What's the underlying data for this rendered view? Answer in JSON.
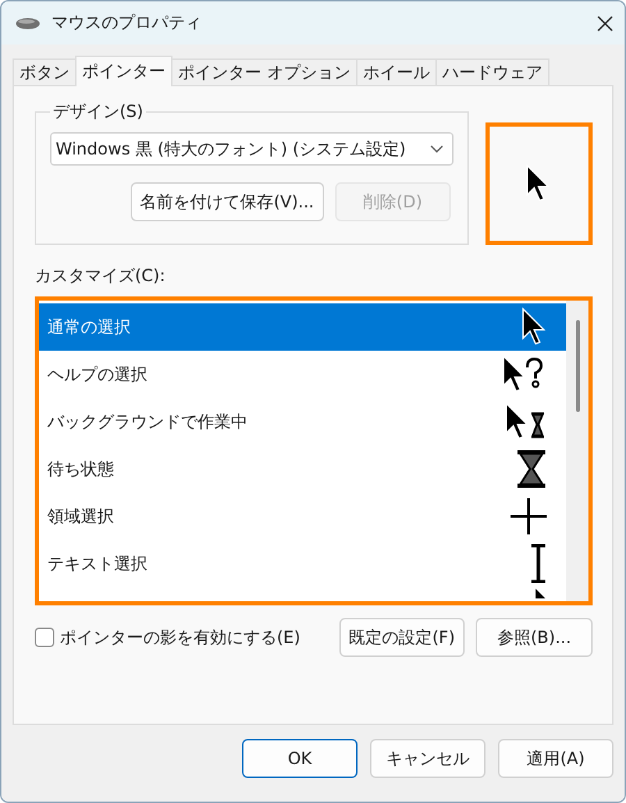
{
  "window": {
    "title": "マウスのプロパティ"
  },
  "tabs": [
    {
      "label": "ボタン",
      "selected": false
    },
    {
      "label": "ポインター",
      "selected": true
    },
    {
      "label": "ポインター オプション",
      "selected": false
    },
    {
      "label": "ホイール",
      "selected": false
    },
    {
      "label": "ハードウェア",
      "selected": false
    }
  ],
  "design": {
    "label": "デザイン(S)",
    "scheme": "Windows 黒 (特大のフォント) (システム設定)",
    "buttons": [
      {
        "label": "名前を付けて保存(V)...",
        "disabled": false
      },
      {
        "label": "削除(D)",
        "disabled": true
      }
    ]
  },
  "preview": {
    "highlighted": true,
    "kind": "arrow"
  },
  "customize": {
    "label": "カスタマイズ(C):",
    "highlighted": true,
    "rows": [
      {
        "label": "通常の選択",
        "kind": "arrow",
        "selected": true
      },
      {
        "label": "ヘルプの選択",
        "kind": "help",
        "selected": false
      },
      {
        "label": "バックグラウンドで作業中",
        "kind": "working",
        "selected": false
      },
      {
        "label": "待ち状態",
        "kind": "busy",
        "selected": false
      },
      {
        "label": "領域選択",
        "kind": "cross",
        "selected": false
      },
      {
        "label": "テキスト選択",
        "kind": "text",
        "selected": false
      },
      {
        "kind": "arrow",
        "selected": false
      }
    ]
  },
  "shadow": {
    "label": "ポインターの影を有効にする(E)",
    "checked": false
  },
  "side_buttons": [
    "既定の設定(F)",
    "参照(B)..."
  ],
  "footer_buttons": [
    {
      "label": "OK",
      "default": true
    },
    {
      "label": "キャンセル",
      "default": false
    },
    {
      "label": "適用(A)",
      "default": false
    }
  ]
}
